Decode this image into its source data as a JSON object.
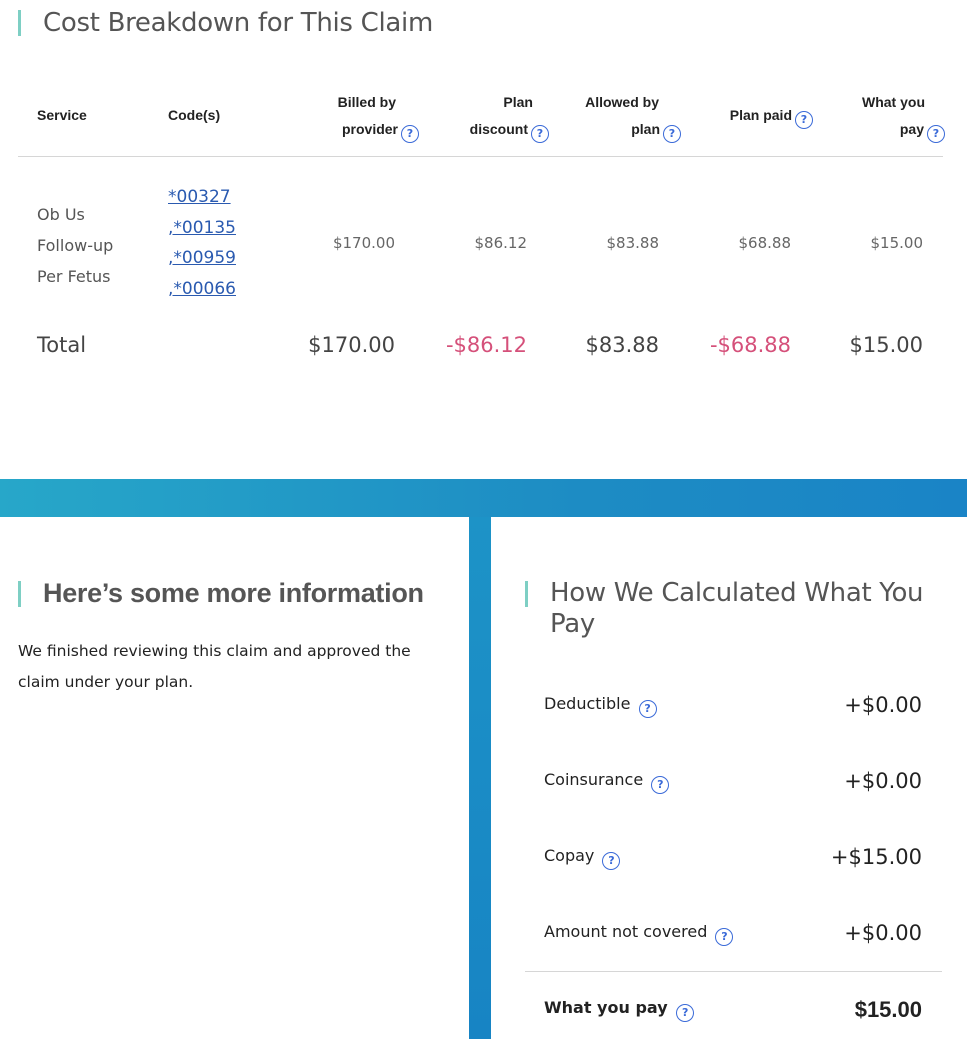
{
  "cost_breakdown": {
    "title": "Cost Breakdown for This Claim",
    "headers": {
      "service": "Service",
      "codes": "Code(s)",
      "billed_line1": "Billed by",
      "billed_line2": "provider",
      "discount_line1": "Plan",
      "discount_line2": "discount",
      "allowed_line1": "Allowed by",
      "allowed_line2": "plan",
      "plan_paid": "Plan paid",
      "you_pay_line1": "What you",
      "you_pay_line2": "pay"
    },
    "row": {
      "service_line1": "Ob Us",
      "service_line2": "Follow-up",
      "service_line3": "Per Fetus",
      "codes": [
        "*00327",
        ",*00135",
        ",*00959",
        ",*00066"
      ],
      "billed": "$170.00",
      "discount": "$86.12",
      "allowed": "$83.88",
      "plan_paid": "$68.88",
      "you_pay": "$15.00"
    },
    "total": {
      "label": "Total",
      "billed": "$170.00",
      "discount": "-$86.12",
      "allowed": "$83.88",
      "plan_paid": "-$68.88",
      "you_pay": "$15.00"
    }
  },
  "more_info": {
    "title": "Here’s some more information",
    "text": "We finished reviewing this claim and approved the claim under your plan."
  },
  "calculation": {
    "title": "How We Calculated What You Pay",
    "rows": [
      {
        "label": "Deductible",
        "value": "+$0.00"
      },
      {
        "label": "Coinsurance",
        "value": "+$0.00"
      },
      {
        "label": "Copay",
        "value": "+$15.00"
      },
      {
        "label": "Amount not covered",
        "value": "+$0.00"
      }
    ],
    "total": {
      "label": "What you pay",
      "value": "$15.00"
    }
  },
  "help_icon": "?",
  "colors": {
    "accent_bar": "#7ecfc4",
    "negative_value": "#d5507a",
    "link": "#2a5ab0",
    "band": "#1d8cc4"
  }
}
